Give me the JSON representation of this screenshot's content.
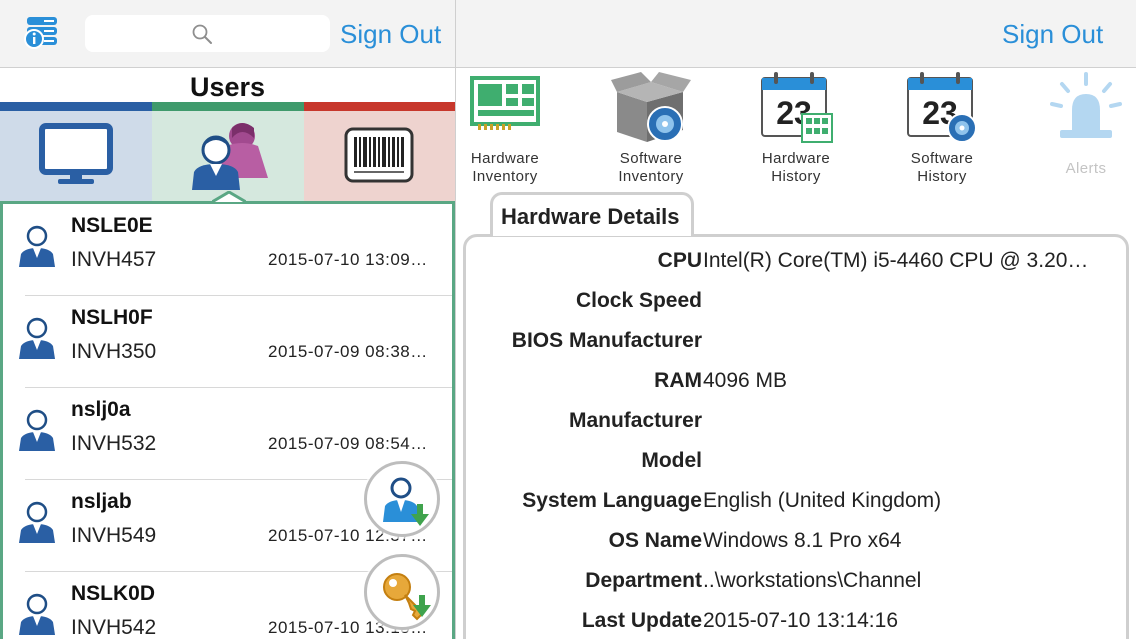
{
  "left_header": {
    "sign_out": "Sign Out",
    "search_placeholder": ""
  },
  "users_title": "Users",
  "tabs": [
    {
      "name": "computers",
      "icon": "monitor-icon",
      "accent": "#2a5fa4"
    },
    {
      "name": "users",
      "icon": "users-icon",
      "accent": "#3f9a6c",
      "selected": true
    },
    {
      "name": "assets",
      "icon": "barcode-icon",
      "accent": "#c7372c"
    }
  ],
  "users": [
    {
      "name": "NSLE0E",
      "inventory": "INVH457",
      "timestamp": "2015-07-10 13:09…"
    },
    {
      "name": "NSLH0F",
      "inventory": "INVH350",
      "timestamp": "2015-07-09 08:38…"
    },
    {
      "name": "nslj0a",
      "inventory": "INVH532",
      "timestamp": "2015-07-09 08:54…"
    },
    {
      "name": "nsljab",
      "inventory": "INVH549",
      "timestamp": "2015-07-10 12:57…"
    },
    {
      "name": "NSLK0D",
      "inventory": "INVH542",
      "timestamp": "2015-07-10 13:15…"
    }
  ],
  "fabs": {
    "user_download": "user-download-icon",
    "key_download": "key-download-icon"
  },
  "right_header": {
    "sign_out": "Sign Out"
  },
  "toolbar": [
    {
      "line1": "Hardware",
      "line2": "Inventory",
      "icon": "hardware-inventory-icon"
    },
    {
      "line1": "Software",
      "line2": "Inventory",
      "icon": "software-inventory-icon"
    },
    {
      "line1": "Hardware",
      "line2": "History",
      "icon": "hardware-history-icon"
    },
    {
      "line1": "Software",
      "line2": "History",
      "icon": "software-history-icon"
    },
    {
      "line1": "Alerts",
      "line2": "",
      "icon": "alert-siren-icon",
      "disabled": true
    }
  ],
  "details": {
    "tab_label": "Hardware Details",
    "rows": [
      {
        "label": "CPU",
        "value": "Intel(R) Core(TM) i5-4460  CPU @ 3.20…"
      },
      {
        "label": "Clock Speed",
        "value": ""
      },
      {
        "label": "BIOS Manufacturer",
        "value": ""
      },
      {
        "label": "RAM",
        "value": "4096 MB"
      },
      {
        "label": "Manufacturer",
        "value": ""
      },
      {
        "label": "Model",
        "value": ""
      },
      {
        "label": "System Language",
        "value": "English (United Kingdom)"
      },
      {
        "label": "OS Name",
        "value": "Windows 8.1 Pro x64"
      },
      {
        "label": "Department",
        "value": "..\\workstations\\Channel"
      },
      {
        "label": "Last Update",
        "value": "2015-07-10 13:14:16"
      }
    ]
  },
  "colors": {
    "accent_blue": "#2a8fd8",
    "list_border": "#5aa784"
  }
}
